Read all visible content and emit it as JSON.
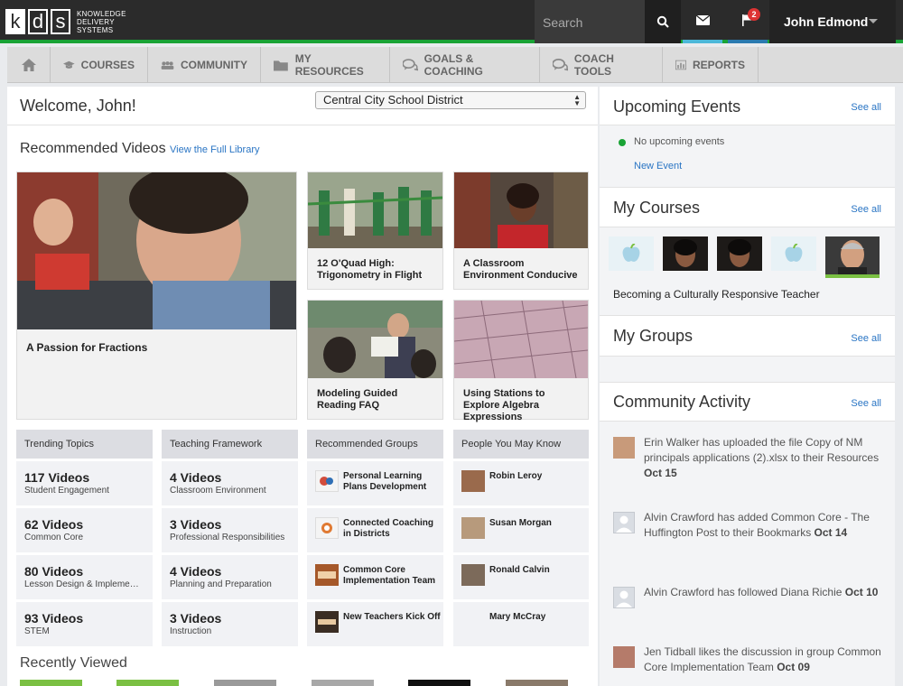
{
  "brand": {
    "letters": [
      "k",
      "d",
      "s"
    ],
    "tagline": [
      "KNOWLEDGE",
      "DELIVERY",
      "SYSTEMS"
    ]
  },
  "header": {
    "search_placeholder": "Search",
    "notification_count": "2",
    "user_name": "John Edmond"
  },
  "nav": [
    "COURSES",
    "COMMUNITY",
    "MY RESOURCES",
    "GOALS & COACHING",
    "COACH TOOLS",
    "REPORTS"
  ],
  "main": {
    "welcome": "Welcome, John!",
    "district": "Central City School District",
    "recommended_title": "Recommended Videos",
    "recommended_link": "View the Full Library",
    "videos": [
      {
        "title": "A Passion for Fractions"
      },
      {
        "title": "12 O'Quad High: Trigonometry in Flight"
      },
      {
        "title": "A Classroom Environment Conducive for Teaching Math..."
      },
      {
        "title": "Modeling Guided Reading FAQ"
      },
      {
        "title": "Using Stations to Explore Algebra Expressions"
      }
    ],
    "trending": {
      "title": "Trending Topics",
      "rows": [
        {
          "count": "117 Videos",
          "topic": "Student Engagement"
        },
        {
          "count": "62 Videos",
          "topic": "Common Core"
        },
        {
          "count": "80 Videos",
          "topic": "Lesson Design & Impleme…"
        },
        {
          "count": "93 Videos",
          "topic": "STEM"
        }
      ]
    },
    "framework": {
      "title": "Teaching Framework",
      "rows": [
        {
          "count": "4 Videos",
          "topic": "Classroom Environment"
        },
        {
          "count": "3 Videos",
          "topic": "Professional Responsibilities"
        },
        {
          "count": "4 Videos",
          "topic": "Planning and Preparation"
        },
        {
          "count": "3 Videos",
          "topic": "Instruction"
        }
      ]
    },
    "groups": {
      "title": "Recommended Groups",
      "rows": [
        "Personal Learning Plans Development",
        "Connected Coaching in Districts",
        "Common Core Implementation Team",
        "New Teachers Kick Off"
      ]
    },
    "people": {
      "title": "People You May Know",
      "rows": [
        "Robin Leroy",
        "Susan Morgan",
        "Ronald Calvin",
        "Mary McCray"
      ]
    },
    "recently_viewed": "Recently Viewed"
  },
  "sidebar": {
    "see_all": "See all",
    "events": {
      "title": "Upcoming Events",
      "empty": "No upcoming events",
      "new_event": "New Event"
    },
    "courses": {
      "title": "My Courses",
      "course_title": "Becoming a Culturally Responsive Teacher"
    },
    "groups": {
      "title": "My Groups"
    },
    "activity": {
      "title": "Community Activity",
      "items": [
        {
          "text": "Erin Walker has uploaded the file Copy of NM principals applications (2).xlsx to their Resources",
          "date": "Oct 15"
        },
        {
          "text": "Alvin Crawford has added Common Core - The Huffington Post to their Bookmarks",
          "date": "Oct 14"
        },
        {
          "text": "Alvin Crawford has followed Diana Richie",
          "date": "Oct 10"
        },
        {
          "text": "Jen Tidball likes the discussion in group Common Core Implementation Team",
          "date": "Oct 09"
        }
      ]
    }
  },
  "colors": {
    "accent_green": "#19a335",
    "link_blue": "#2a75c4",
    "topbar": "#2b2b2b"
  }
}
